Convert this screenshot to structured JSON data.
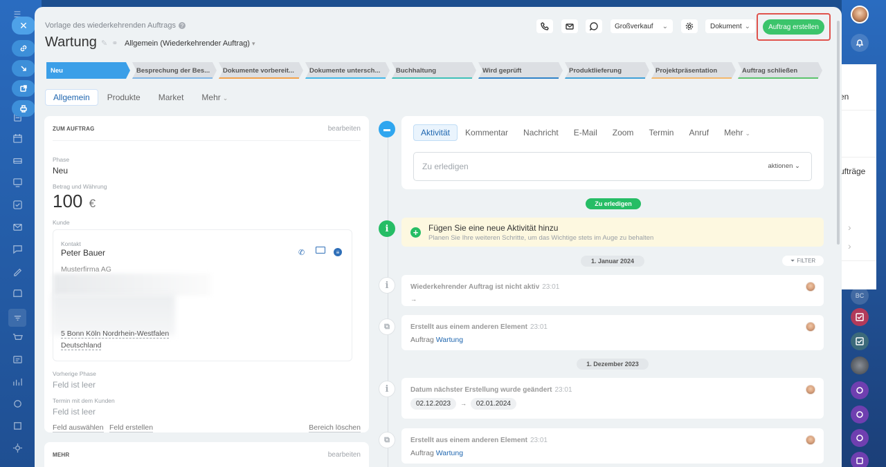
{
  "right_panel": {
    "item1": "en",
    "item2": "ufträge",
    "badge": "BC"
  },
  "header": {
    "subtitle": "Vorlage des wiederkehrenden Auftrags",
    "title": "Wartung",
    "category": "Allgemein (Wiederkehrender Auftrag)",
    "pipeline": "Großverkauf",
    "document": "Dokument",
    "create_button": "Auftrag erstellen"
  },
  "stages": [
    {
      "label": "Neu",
      "color": "#3b9fe8"
    },
    {
      "label": "Besprechung der Bes...",
      "color": "#7fb6e6"
    },
    {
      "label": "Dokumente vorbereit...",
      "color": "#f2a14a"
    },
    {
      "label": "Dokumente untersch...",
      "color": "#42b8e8"
    },
    {
      "label": "Buchhaltung",
      "color": "#3fc0b8"
    },
    {
      "label": "Wird geprüft",
      "color": "#2f82c8"
    },
    {
      "label": "Produktlieferung",
      "color": "#3ea0d8"
    },
    {
      "label": "Projektpräsentation",
      "color": "#f4b86a"
    },
    {
      "label": "Auftrag schließen",
      "color": "#5cc36c"
    }
  ],
  "tabs": [
    "Allgemein",
    "Produkte",
    "Market",
    "Mehr"
  ],
  "left": {
    "section_title": "ZUM AUFTRAG",
    "edit": "bearbeiten",
    "phase_label": "Phase",
    "phase_value": "Neu",
    "amount_label": "Betrag und Währung",
    "amount": "100",
    "currency": "€",
    "client_label": "Kunde",
    "contact_label": "Kontakt",
    "contact_name": "Peter Bauer",
    "company": "Musterfirma AG",
    "address": "5 Bonn Köln Nordrhein-Westfalen",
    "country": "Deutschland",
    "prev_phase_label": "Vorherige Phase",
    "prev_phase_value": "Feld ist leer",
    "meeting_label": "Termin mit dem Kunden",
    "meeting_value": "Feld ist leer",
    "link_select": "Feld auswählen",
    "link_create": "Feld erstellen",
    "link_delete": "Bereich löschen",
    "section2_title": "MEHR",
    "edit2": "bearbeiten"
  },
  "activity": {
    "tabs": [
      "Aktivität",
      "Kommentar",
      "Nachricht",
      "E-Mail",
      "Zoom",
      "Termin",
      "Anruf",
      "Mehr"
    ],
    "todo_placeholder": "Zu erledigen",
    "aktionen": "aktionen",
    "todo_pill": "Zu erledigen",
    "add_title": "Fügen Sie eine neue Aktivität hinzu",
    "add_hint": "Planen Sie Ihre weiteren Schritte, um das Wichtige stets im Auge zu behalten",
    "date1": "1. Januar 2024",
    "filter": "FILTER",
    "date2": "1. Dezember 2023"
  },
  "events": [
    {
      "title": "Wiederkehrender Auftrag ist nicht aktiv",
      "time": "23:01",
      "body": "→"
    },
    {
      "title": "Erstellt aus einem anderen Element",
      "time": "23:01",
      "body_prefix": "Auftrag",
      "link": "Wartung"
    },
    {
      "title": "Datum nächster Erstellung wurde geändert",
      "time": "23:01",
      "from": "02.12.2023",
      "arrow": "→",
      "to": "02.01.2024"
    },
    {
      "title": "Erstellt aus einem anderen Element",
      "time": "23:01",
      "body_prefix": "Auftrag",
      "link": "Wartung"
    }
  ]
}
